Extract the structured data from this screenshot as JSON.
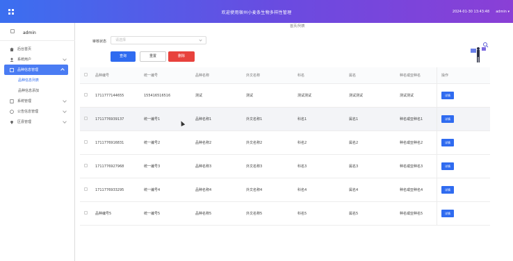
{
  "header": {
    "title": "欢迎使用宿州小麦条生物多样性管理",
    "clock": "2024-01-30 13:43:48",
    "user": "admin"
  },
  "sidebar": {
    "profile_name": "admin",
    "items": [
      {
        "label": "后台首页",
        "icon": "home-icon"
      },
      {
        "label": "系统用户",
        "icon": "user-icon"
      },
      {
        "label": "品种信息管理",
        "icon": "clipboard-icon"
      },
      {
        "label": "品种信息列表",
        "icon": ""
      },
      {
        "label": "品种信息添加",
        "icon": ""
      },
      {
        "label": "系统管理",
        "icon": "document-icon"
      },
      {
        "label": "公告信息管理",
        "icon": "clock-icon"
      },
      {
        "label": "区县管理",
        "icon": "location-icon"
      }
    ]
  },
  "breadcrumb": "首页/列表",
  "search": {
    "label": "审核状态",
    "placeholder": "请选择"
  },
  "buttons": {
    "search": "查询",
    "reset": "重置",
    "delete": "删除",
    "detail": "详情"
  },
  "table": {
    "headers": [
      "品种编号",
      "统一编号",
      "品种名称",
      "外文名称",
      "科名",
      "属名",
      "种名或亚种名",
      "操作"
    ],
    "rows": [
      [
        "1711777144655",
        "155416516516",
        "测试",
        "测试",
        "测试测试",
        "测试测试",
        "测试测试"
      ],
      [
        "1711776939137",
        "统一编号1",
        "品种名称1",
        "外文名称1",
        "科名1",
        "属名1",
        "种名或亚种名1"
      ],
      [
        "1711776916831",
        "统一编号2",
        "品种名称2",
        "外文名称2",
        "科名2",
        "属名2",
        "种名或亚种名2"
      ],
      [
        "1711776927968",
        "统一编号3",
        "品种名称3",
        "外文名称3",
        "科名3",
        "属名3",
        "种名或亚种名3"
      ],
      [
        "1711776933295",
        "统一编号4",
        "品种名称4",
        "外文名称4",
        "科名4",
        "属名4",
        "种名或亚种名4"
      ],
      [
        "品种编号5",
        "统一编号5",
        "品种名称5",
        "外文名称5",
        "科名5",
        "属名5",
        "种名或亚种名5"
      ]
    ]
  },
  "colors": {
    "primary": "#2f6bf0",
    "danger": "#e8423d",
    "header_gradient_start": "#3b6ff0",
    "header_gradient_end": "#8a3fd6"
  }
}
